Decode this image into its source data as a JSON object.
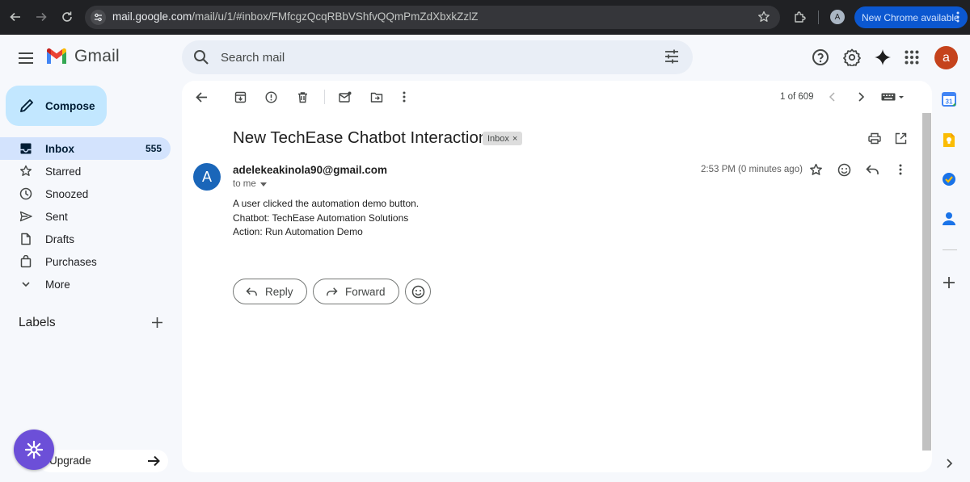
{
  "browser": {
    "url_host": "mail.google.com",
    "url_path": "/mail/u/1/#inbox/FMfcgzQcqRBbVShfvQQmPmZdXbxkZzlZ",
    "profile_initial": "A",
    "update_button": "New Chrome available"
  },
  "app": {
    "name": "Gmail",
    "user_initial": "a"
  },
  "search": {
    "placeholder": "Search mail"
  },
  "sidebar": {
    "compose_label": "Compose",
    "items": [
      {
        "label": "Inbox",
        "count": "555",
        "icon": "inbox-icon",
        "active": true
      },
      {
        "label": "Starred",
        "icon": "star-icon"
      },
      {
        "label": "Snoozed",
        "icon": "clock-icon"
      },
      {
        "label": "Sent",
        "icon": "send-icon"
      },
      {
        "label": "Drafts",
        "icon": "draft-icon"
      },
      {
        "label": "Purchases",
        "icon": "purchases-icon"
      },
      {
        "label": "More",
        "icon": "chevron-down-icon"
      }
    ],
    "labels_title": "Labels",
    "upgrade_label": "Upgrade"
  },
  "message_toolbar": {
    "pager": "1 of 609"
  },
  "message": {
    "subject": "New TechEase Chatbot Interaction",
    "badge": "Inbox",
    "badge_close": "×",
    "sender_initial": "A",
    "sender": "adelekeakinola90@gmail.com",
    "recipient": "to me",
    "time": "2:53 PM (0 minutes ago)",
    "body": [
      "A user clicked the automation demo button.",
      "Chatbot: TechEase Automation Solutions",
      "Action: Run Automation Demo"
    ],
    "reply_label": "Reply",
    "forward_label": "Forward"
  },
  "colors": {
    "accent": "#0b57d0",
    "compose_bg": "#c2e7ff",
    "active_nav": "#d3e3fd",
    "user_avatar": "#c5431c",
    "sender_avatar": "#1a66b9"
  }
}
